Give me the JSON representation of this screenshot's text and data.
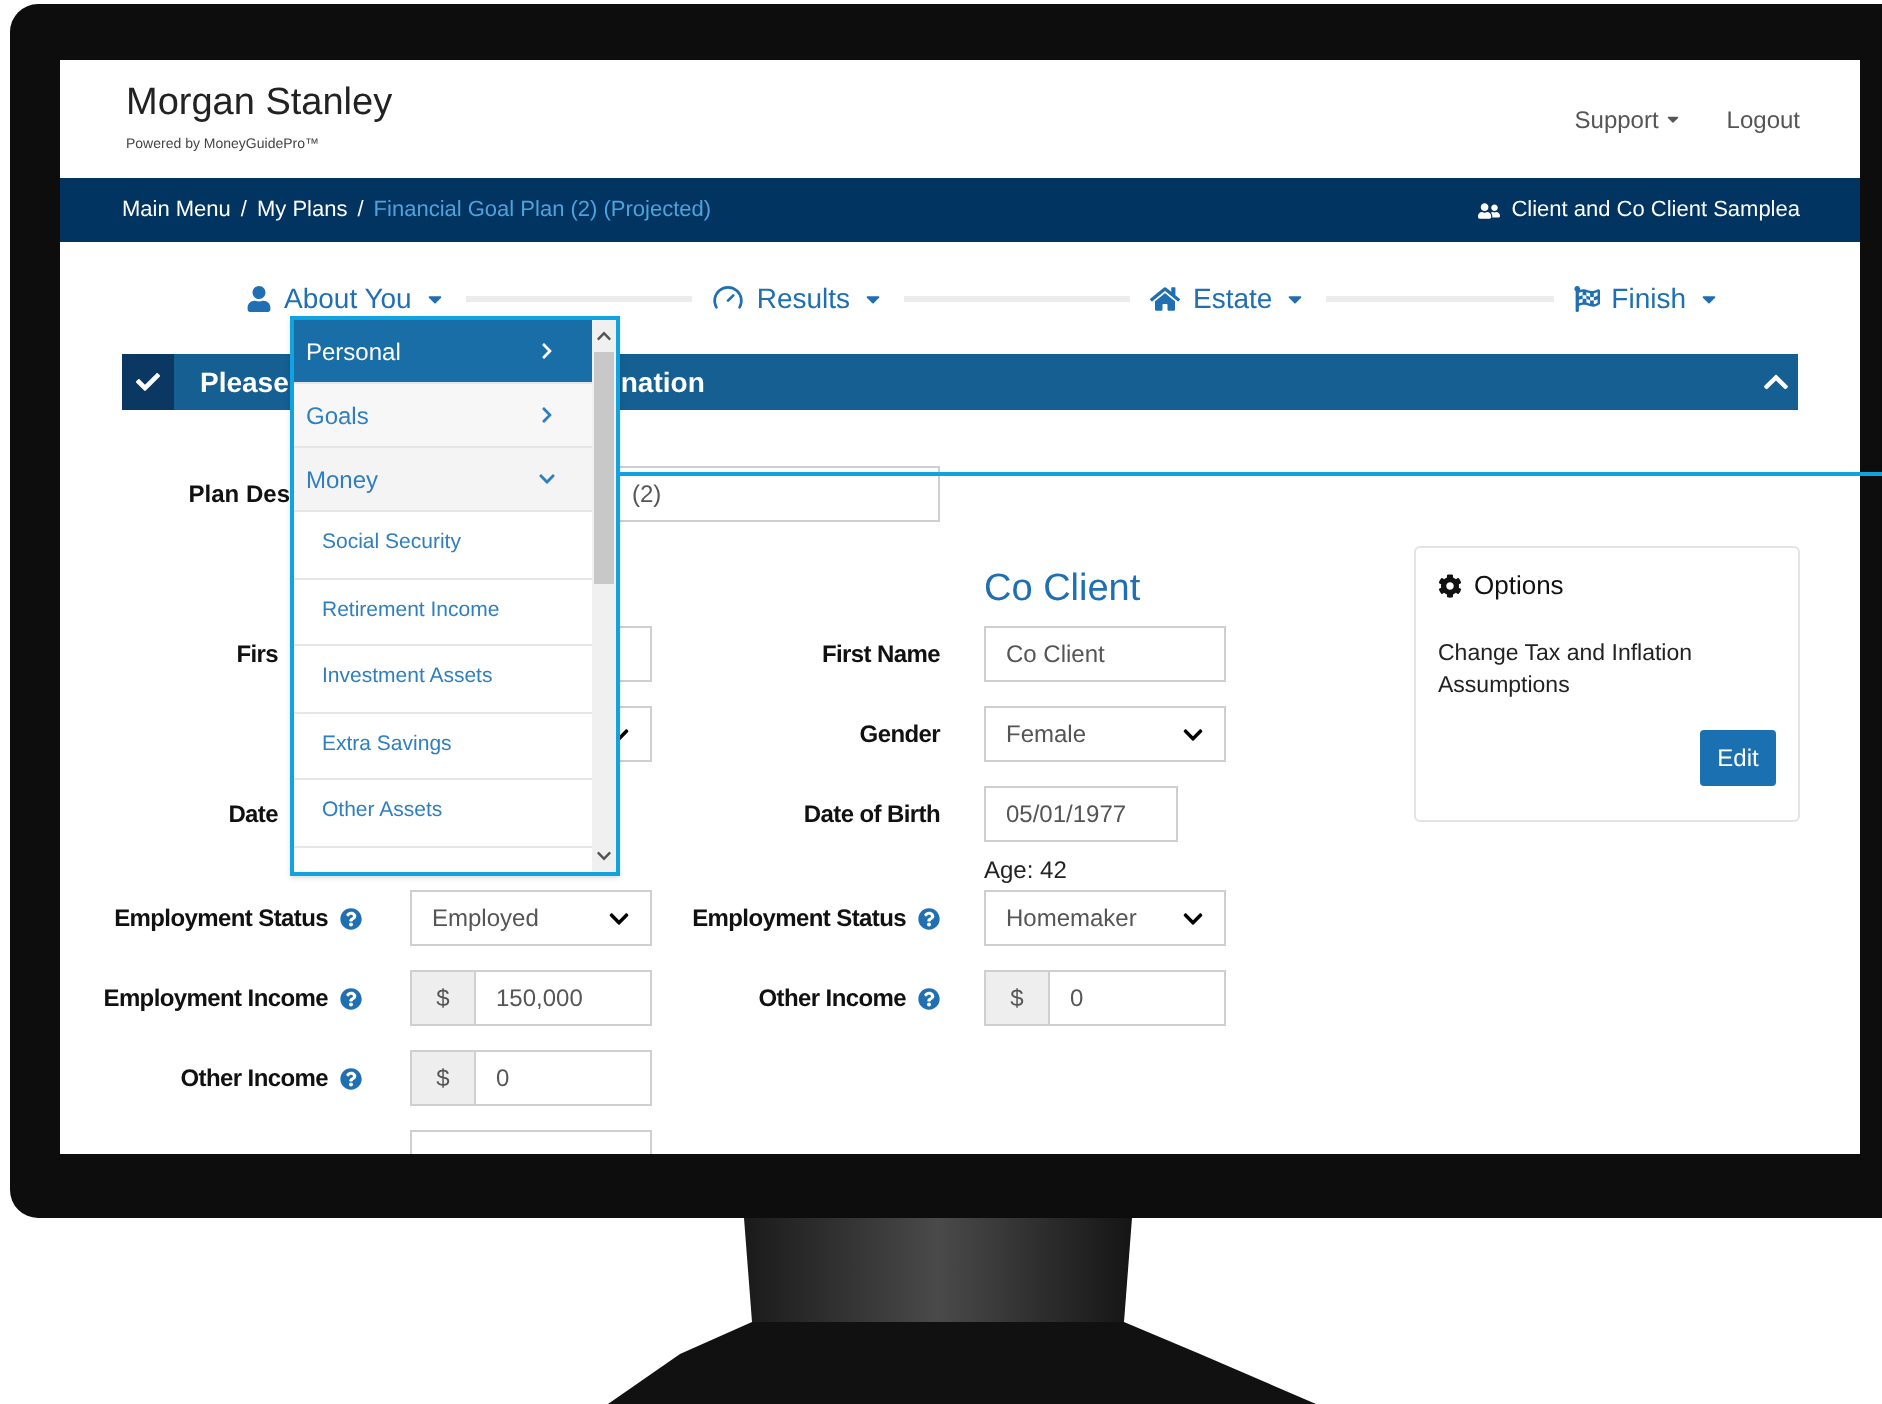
{
  "header": {
    "logo": "Morgan Stanley",
    "tagline": "Powered by MoneyGuidePro™",
    "links": [
      {
        "label": "Support",
        "dropdown": true
      },
      {
        "label": "Logout",
        "dropdown": false
      }
    ]
  },
  "breadcrumb": {
    "items": [
      {
        "label": "Main Menu",
        "current": false
      },
      {
        "label": "My Plans",
        "current": false
      },
      {
        "label": "Financial Goal Plan (2) (Projected)",
        "current": true
      }
    ],
    "separator": "/",
    "client": "Client and Co Client Samplea"
  },
  "steps": [
    {
      "label": "About You"
    },
    {
      "label": "Results"
    },
    {
      "label": "Estate"
    },
    {
      "label": "Finish"
    }
  ],
  "section": {
    "title_start": "Please",
    "title_end": "nation",
    "checked": true,
    "expanded": true
  },
  "menu": {
    "items": [
      {
        "label": "Personal",
        "selected": true,
        "expanded": false
      },
      {
        "label": "Goals",
        "selected": false,
        "expanded": false
      },
      {
        "label": "Money",
        "selected": false,
        "expanded": true,
        "children": [
          {
            "label": "Social Security"
          },
          {
            "label": "Retirement Income"
          },
          {
            "label": "Investment Assets"
          },
          {
            "label": "Extra Savings"
          },
          {
            "label": "Other Assets"
          }
        ]
      }
    ]
  },
  "form": {
    "plan_description": {
      "label": "Plan Des",
      "value": "(2)"
    },
    "co_client_heading": "Co Client",
    "rows": [
      {
        "left": {
          "label": "Firs",
          "kind": "text",
          "help": false
        },
        "right": {
          "label": "First Name",
          "kind": "text",
          "value": "Co Client",
          "help": false
        }
      },
      {
        "left": {
          "kind": "select"
        },
        "right": {
          "label": "Gender",
          "kind": "select",
          "value": "Female",
          "help": false
        }
      },
      {
        "left": {
          "label": "Date",
          "kind": "none",
          "help": false
        },
        "right": {
          "label": "Date of Birth",
          "kind": "date",
          "value": "05/01/1977",
          "note": "Age: 42",
          "help": false
        }
      },
      {
        "left": {
          "label": "Employment Status",
          "kind": "select",
          "value": "Employed",
          "help": true
        },
        "right": {
          "label": "Employment Status",
          "kind": "select",
          "value": "Homemaker",
          "help": true
        }
      },
      {
        "left": {
          "label": "Employment Income",
          "kind": "money",
          "prefix": "$",
          "value": "150,000",
          "help": true
        },
        "right": {
          "label": "Other Income",
          "kind": "money",
          "prefix": "$",
          "value": "0",
          "help": true
        }
      },
      {
        "left": {
          "label": "Other Income",
          "kind": "money",
          "prefix": "$",
          "value": "0",
          "help": true
        }
      },
      {
        "left": {
          "kind": "text"
        }
      }
    ]
  },
  "options": {
    "title": "Options",
    "text": "Change Tax and Inflation Assumptions",
    "button": "Edit"
  }
}
